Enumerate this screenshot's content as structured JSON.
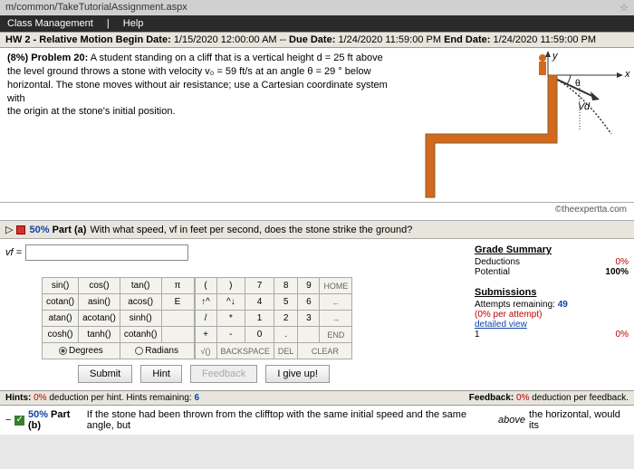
{
  "url": "m/common/TakeTutorialAssignment.aspx",
  "nav": {
    "class_mgmt": "Class Management",
    "sep": "|",
    "help": "Help"
  },
  "hw_header": {
    "title": "HW 2 - Relative Motion",
    "begin_label": "Begin Date:",
    "begin": "1/15/2020 12:00:00 AM",
    "dash": "--",
    "due_label": "Due Date:",
    "due": "1/24/2020 11:59:00 PM",
    "end_label": "End Date:",
    "end": "1/24/2020 11:59:00 PM"
  },
  "problem": {
    "weight": "(8%)",
    "label": "Problem 20:",
    "line1": "A student standing on a cliff that is a vertical height d = 25 ft above",
    "line2": "the level ground throws a stone with velocity v₀ = 59 ft/s at an angle θ = 29 ° below",
    "line3": "horizontal. The stone moves without air resistance; use a Cartesian coordinate system with",
    "line4": "the origin at the stone's initial position."
  },
  "copyright": "©theexpertta.com",
  "part_a": {
    "pct": "50%",
    "label": "Part (a)",
    "question": "With what speed, vf in feet per second, does the stone strike the ground?",
    "var": "vf =",
    "input_value": ""
  },
  "keypad": {
    "funcs": [
      [
        "sin()",
        "cos()",
        "tan()",
        "π"
      ],
      [
        "cotan()",
        "asin()",
        "acos()",
        "E"
      ],
      [
        "atan()",
        "acotan()",
        "sinh()",
        ""
      ],
      [
        "cosh()",
        "tanh()",
        "cotanh()",
        ""
      ]
    ],
    "nums": [
      [
        "(",
        ")",
        "7",
        "8",
        "9",
        "HOME"
      ],
      [
        "↑^",
        "^↓",
        "4",
        "5",
        "6",
        "←"
      ],
      [
        "/",
        "*",
        "1",
        "2",
        "3",
        "→"
      ],
      [
        "+",
        "-",
        "0",
        ".",
        "",
        "END"
      ]
    ],
    "bottom_labels": [
      "√()",
      "BACKSPACE",
      "DEL",
      "CLEAR"
    ],
    "mode_deg": "Degrees",
    "mode_rad": "Radians"
  },
  "buttons": {
    "submit": "Submit",
    "hint": "Hint",
    "feedback": "Feedback",
    "giveup": "I give up!"
  },
  "summary": {
    "title": "Grade Summary",
    "ded_label": "Deductions",
    "ded_val": "0%",
    "pot_label": "Potential",
    "pot_val": "100%",
    "sub_title": "Submissions",
    "attempts_label": "Attempts remaining:",
    "attempts_val": "49",
    "per_attempt": "(0% per attempt)",
    "detailed": "detailed view",
    "row1_a": "1",
    "row1_b": "0%"
  },
  "footer": {
    "hints_label": "Hints:",
    "hints_pct": "0%",
    "hints_text": "deduction per hint. Hints remaining:",
    "hints_remaining": "6",
    "fb_label": "Feedback:",
    "fb_pct": "0%",
    "fb_text": "deduction per feedback."
  },
  "part_b": {
    "pct": "50%",
    "label": "Part (b)",
    "text": "If the stone had been thrown from the clifftop with the same initial speed and the same angle, but ",
    "italic": "above",
    "text2": " the horizontal, would its"
  }
}
